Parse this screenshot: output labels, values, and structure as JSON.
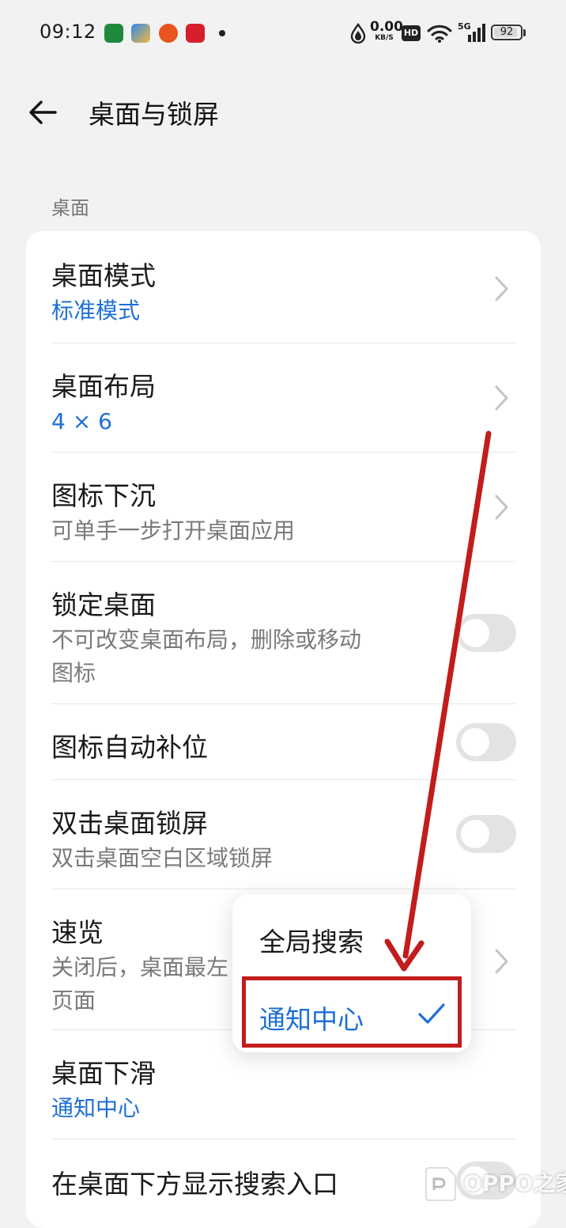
{
  "status_bar": {
    "time": "09:12",
    "net_speed_value": "0.00",
    "net_speed_unit": "KB/S",
    "hd_badge": "HD",
    "network": "5G",
    "battery": "92",
    "icons": [
      "oppo-app-icon",
      "gallery-app-icon",
      "basketball-app-icon",
      "red-app-icon",
      "notification-dot",
      "data-saver-icon",
      "wifi-icon",
      "signal-icon",
      "battery-icon"
    ]
  },
  "header": {
    "title": "桌面与锁屏",
    "back_icon": "back-arrow-icon"
  },
  "section": {
    "label": "桌面"
  },
  "settings": {
    "desktop_mode": {
      "title": "桌面模式",
      "value": "标准模式"
    },
    "desktop_layout": {
      "title": "桌面布局",
      "value": "4 × 6"
    },
    "icon_sink": {
      "title": "图标下沉",
      "desc": "可单手一步打开桌面应用"
    },
    "lock_desktop": {
      "title": "锁定桌面",
      "desc_line1": "不可改变桌面布局，删除或移动",
      "desc_line2": "图标",
      "enabled": false
    },
    "auto_fill": {
      "title": "图标自动补位",
      "enabled": false
    },
    "double_tap_lock": {
      "title": "双击桌面锁屏",
      "desc": "双击桌面空白区域锁屏",
      "enabled": false
    },
    "preview": {
      "title": "速览",
      "desc_line1": "关闭后，桌面最左",
      "desc_line2": "页面"
    },
    "swipe_down": {
      "title": "桌面下滑",
      "value": "通知中心"
    },
    "show_search": {
      "title": "在桌面下方显示搜索入口"
    }
  },
  "popup": {
    "options": [
      {
        "label": "全局搜索",
        "selected": false
      },
      {
        "label": "通知中心",
        "selected": true
      }
    ]
  },
  "watermark": {
    "text": "OPPO之家"
  },
  "colors": {
    "accent": "#1e6fd6",
    "annotation_red": "#c11d1d",
    "background": "#f2f2f2"
  }
}
